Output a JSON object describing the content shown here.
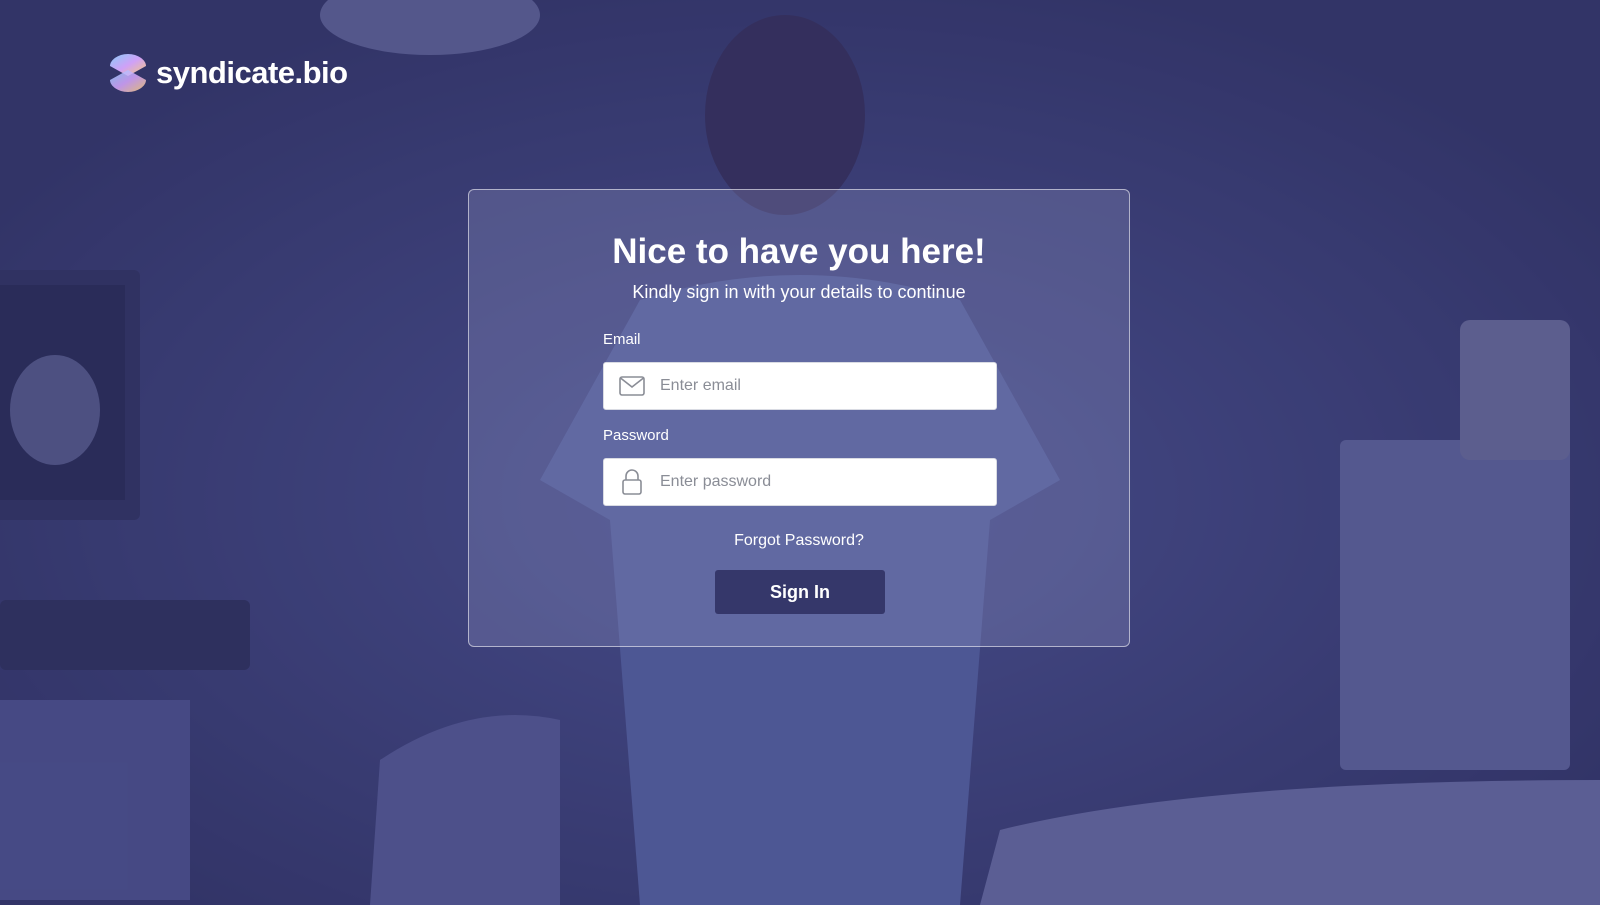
{
  "brand": {
    "name": "syndicate.bio",
    "logo_icon": "syndicate-logo-icon"
  },
  "login": {
    "title": "Nice to have you here!",
    "subtitle": "Kindly sign in with your details to continue",
    "email": {
      "label": "Email",
      "placeholder": "Enter email",
      "value": "",
      "icon": "mail-icon"
    },
    "password": {
      "label": "Password",
      "placeholder": "Enter password",
      "value": "",
      "icon": "lock-icon"
    },
    "forgot_label": "Forgot Password?",
    "signin_label": "Sign In"
  },
  "colors": {
    "overlay": "#3b3d6a",
    "button": "#35376a",
    "text": "#ffffff"
  }
}
